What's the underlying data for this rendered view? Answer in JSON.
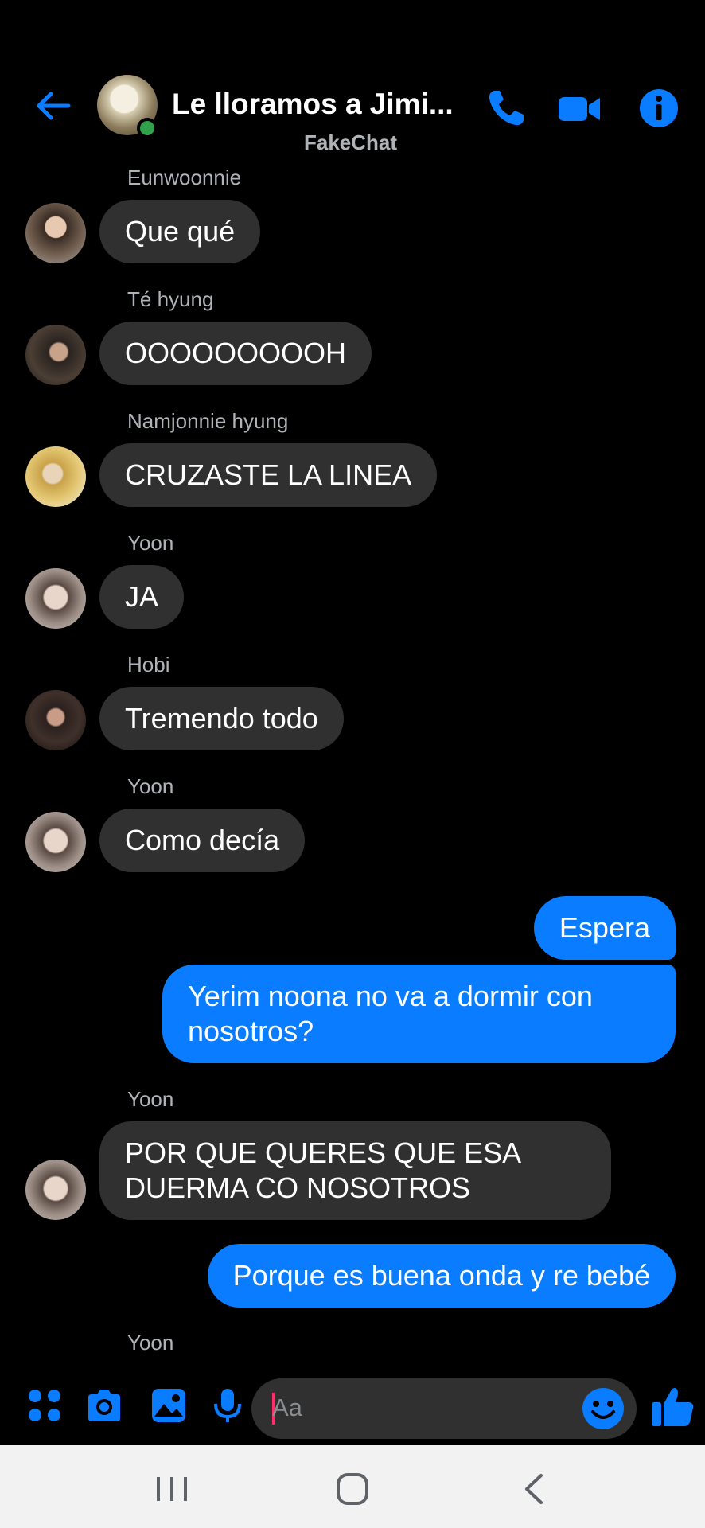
{
  "header": {
    "title": "Le lloramos a Jimi...",
    "subtitle": "FakeChat",
    "online": true
  },
  "messages": [
    {
      "type": "in",
      "sender": "Eunwoonnie",
      "text": "Que qué"
    },
    {
      "type": "in",
      "sender": "Té hyung",
      "text": "OOOOOOOOOH"
    },
    {
      "type": "in",
      "sender": "Namjonnie hyung",
      "text": "CRUZASTE LA LINEA"
    },
    {
      "type": "in",
      "sender": "Yoon",
      "text": "JA"
    },
    {
      "type": "in",
      "sender": "Hobi",
      "text": "Tremendo todo"
    },
    {
      "type": "in",
      "sender": "Yoon",
      "text": "Como decía"
    },
    {
      "type": "out",
      "text": "Espera"
    },
    {
      "type": "out",
      "text": "Yerim noona no va a dormir con nosotros?"
    },
    {
      "type": "in",
      "sender": "Yoon",
      "text": "POR QUE QUERES QUE ESA DUERMA CO NOSOTROS"
    },
    {
      "type": "out",
      "text": "Porque es buena onda y re bebé"
    },
    {
      "type": "in",
      "sender": "Yoon",
      "text": ""
    }
  ],
  "composer": {
    "placeholder": "Aa"
  },
  "colors": {
    "accent": "#0a7cff",
    "incoming_bubble": "#303030",
    "online": "#31a24c",
    "background": "#000000"
  },
  "icons": {
    "back": "arrow-left-icon",
    "call": "phone-icon",
    "video": "video-camera-icon",
    "info": "info-icon",
    "apps": "four-dots-icon",
    "camera": "camera-icon",
    "gallery": "image-icon",
    "mic": "microphone-icon",
    "emoji": "smiley-icon",
    "like": "thumbs-up-icon",
    "nav_recents": "recents-icon",
    "nav_home": "home-icon",
    "nav_back": "nav-back-icon"
  }
}
